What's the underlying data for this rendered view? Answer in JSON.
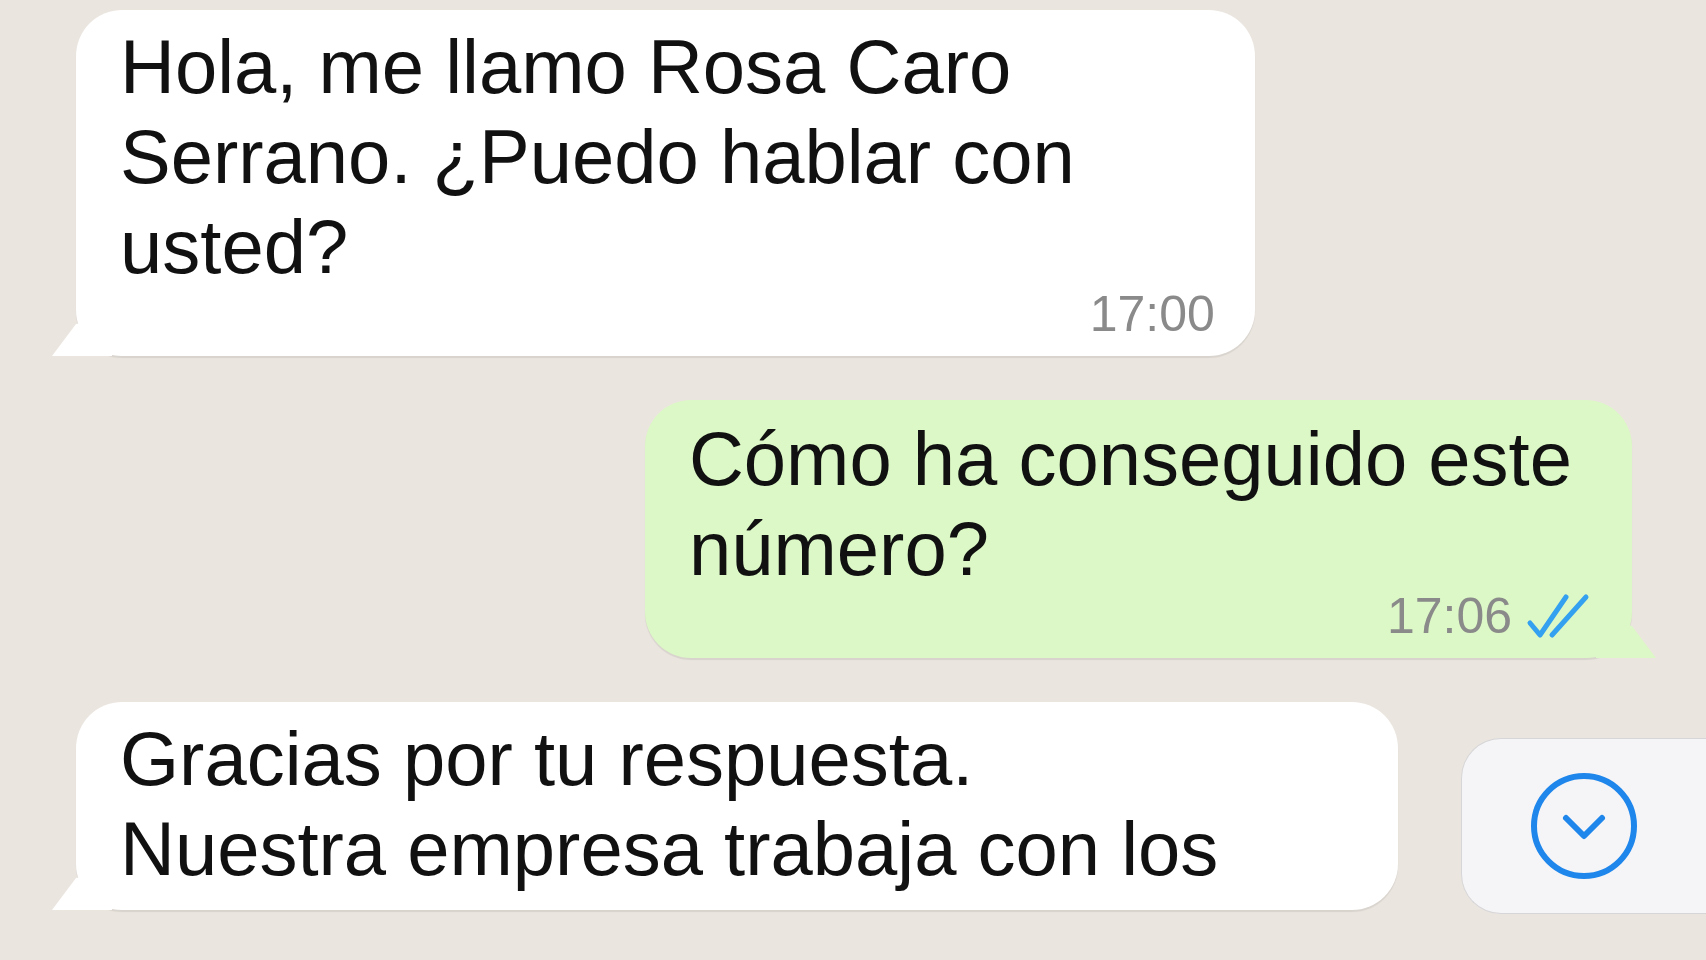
{
  "messages": [
    {
      "kind": "incoming",
      "lines": [
        "Hola, me llamo Rosa Caro",
        "Serrano. ¿Puedo hablar con",
        "usted?"
      ],
      "time": "17:00"
    },
    {
      "kind": "outgoing",
      "lines": [
        "Cómo ha conseguido este",
        "número?"
      ],
      "time": "17:06",
      "read": true
    },
    {
      "kind": "incoming",
      "lines": [
        "Gracias por tu respuesta.",
        "Nuestra empresa trabaja con los"
      ]
    }
  ],
  "scroll_button": {
    "kind": "scroll-down"
  }
}
